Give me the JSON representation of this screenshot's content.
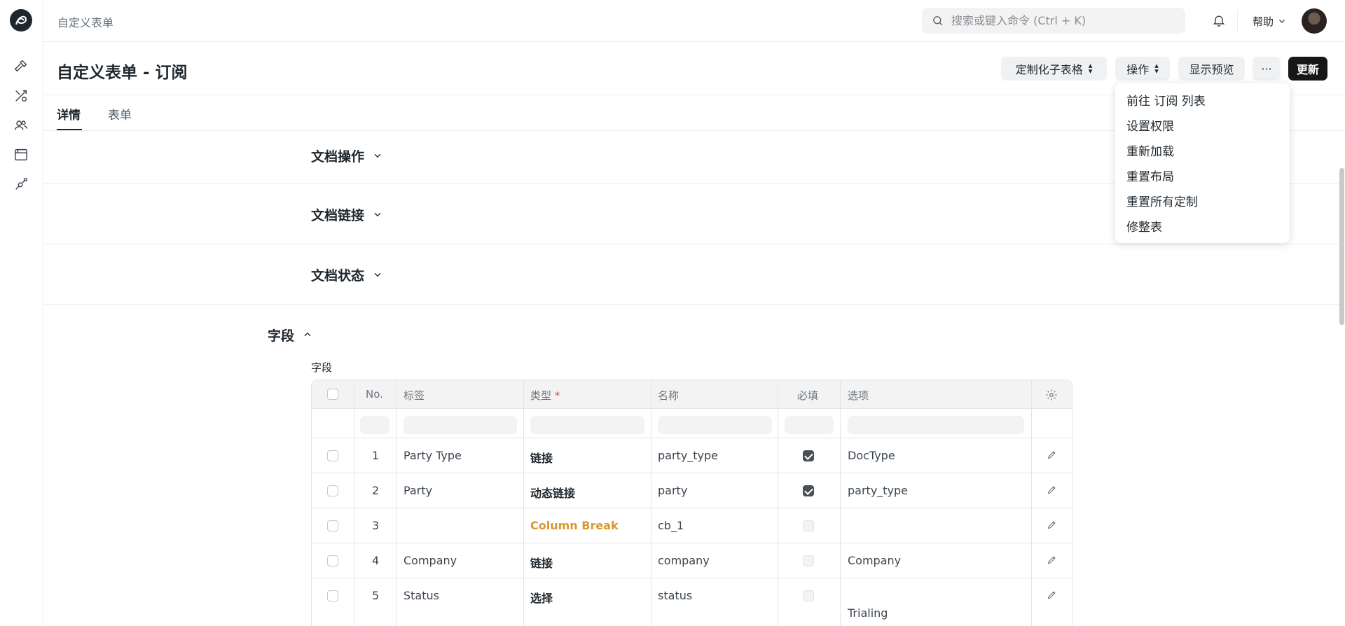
{
  "navbar": {
    "breadcrumb": "自定义表单",
    "search_placeholder": "搜索或键入命令 (Ctrl + K)",
    "help_label": "帮助"
  },
  "sidebar": {
    "icons": [
      "hammer-icon",
      "tools-icon",
      "users-icon",
      "window-icon",
      "integrations-icon"
    ]
  },
  "page": {
    "title": "自定义表单 - 订阅",
    "buttons": {
      "customize_child": "定制化子表格",
      "actions": "操作",
      "preview": "显示预览",
      "more": "···",
      "update": "更新"
    }
  },
  "tabs": [
    {
      "label": "详情",
      "active": true
    },
    {
      "label": "表单",
      "active": false
    }
  ],
  "sections": [
    {
      "title": "文档操作",
      "expanded": false
    },
    {
      "title": "文档链接",
      "expanded": false
    },
    {
      "title": "文档状态",
      "expanded": false
    },
    {
      "title": "字段",
      "expanded": true
    }
  ],
  "fields_table": {
    "label": "字段",
    "headers": {
      "no": "No.",
      "label": "标签",
      "type": "类型",
      "required_mark": "*",
      "name": "名称",
      "mandatory": "必填",
      "options": "选项"
    },
    "rows": [
      {
        "no": "1",
        "label": "Party Type",
        "type": "链接",
        "name": "party_type",
        "mandatory": true,
        "options": "DocType"
      },
      {
        "no": "2",
        "label": "Party",
        "type": "动态链接",
        "name": "party",
        "mandatory": true,
        "options": "party_type"
      },
      {
        "no": "3",
        "label": "",
        "type": "Column Break",
        "name": "cb_1",
        "mandatory": false,
        "options": ""
      },
      {
        "no": "4",
        "label": "Company",
        "type": "链接",
        "name": "company",
        "mandatory": false,
        "options": "Company"
      },
      {
        "no": "5",
        "label": "Status",
        "type": "选择",
        "name": "status",
        "mandatory": false,
        "options": "Trialing"
      }
    ]
  },
  "dropdown": {
    "items": [
      "前往 订阅 列表",
      "设置权限",
      "重新加载",
      "重置布局",
      "重置所有定制",
      "修整表"
    ]
  },
  "colors": {
    "accent_dark": "#171717",
    "column_break": "#d9982f",
    "required": "#e24c4c"
  }
}
